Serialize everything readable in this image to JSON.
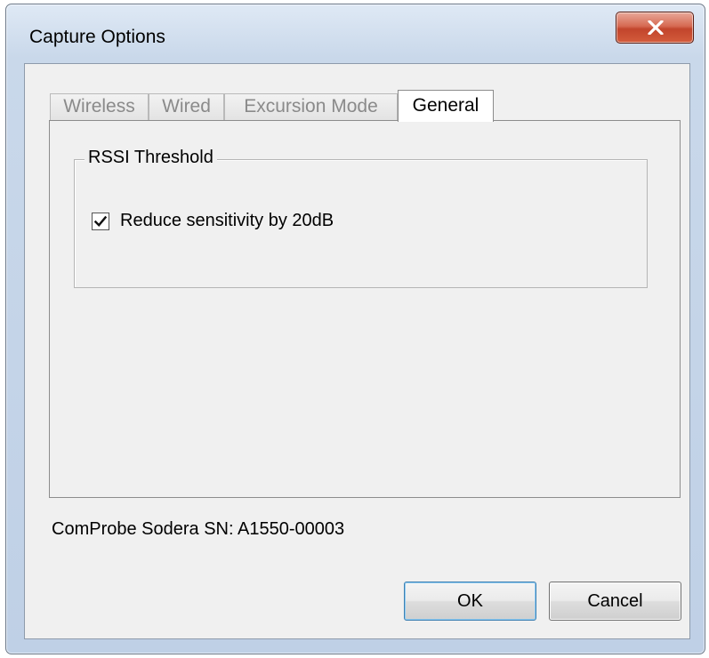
{
  "window": {
    "title": "Capture Options",
    "close_label": "X"
  },
  "tabs": [
    {
      "label": "Wireless",
      "active": false
    },
    {
      "label": "Wired",
      "active": false
    },
    {
      "label": "Excursion Mode",
      "active": false
    },
    {
      "label": "General",
      "active": true
    }
  ],
  "rssi": {
    "group_label": "RSSI Threshold",
    "checkbox_label": "Reduce sensitivity by 20dB",
    "checked": true
  },
  "serial_text": "ComProbe Sodera SN: A1550-00003",
  "buttons": {
    "ok_label": "OK",
    "cancel_label": "Cancel"
  },
  "colors": {
    "frame": "#c9d8ea",
    "close_button": "#c2452c",
    "client_bg": "#f0f0f0"
  },
  "icons": {
    "close": "close-icon",
    "check": "checkmark-icon"
  }
}
